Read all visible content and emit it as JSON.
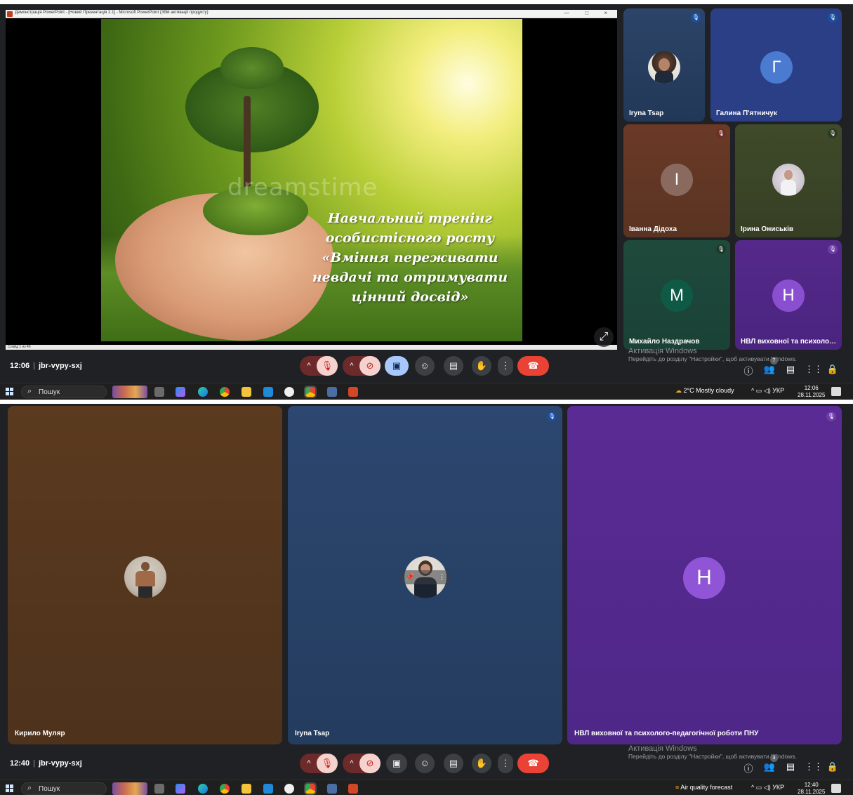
{
  "shot1": {
    "presentation": {
      "window_title": "Демонстрація PowerPoint - [Новий Презентація 2.1] - Microsoft PowerPoint (Збій активації продукту)",
      "window_controls": "— □ ×",
      "slide_lines": [
        "Навчальний тренінг",
        "особистісного росту",
        "«Вміння переживати",
        "невдачі та отримувати",
        "цінний досвід»"
      ],
      "watermark": "dreamstime",
      "status_left": "Слайд 1 из 46"
    },
    "participants": [
      {
        "name": "Iryna Tsap",
        "type": "photo"
      },
      {
        "name": "Галина П'ятничук",
        "type": "letter",
        "letter": "Г"
      },
      {
        "name": "Іванна Дідоха",
        "type": "letter",
        "letter": "І"
      },
      {
        "name": "Ірина Ониськів",
        "type": "photo"
      },
      {
        "name": "Михайло Наздрачов",
        "type": "letter",
        "letter": "М"
      },
      {
        "name": "НВЛ виховної та психоло…",
        "type": "letter",
        "letter": "Н"
      }
    ],
    "meeting": {
      "time": "12:06",
      "code": "jbr-vypy-sxj"
    },
    "participants_badge": "7",
    "taskbar": {
      "weather": "2°C Mostly cloudy",
      "lang": "УКР",
      "time": "12:06",
      "date": "28.11.2025"
    }
  },
  "shot2": {
    "participants": [
      {
        "name": "Кирило Муляр",
        "type": "photo"
      },
      {
        "name": "Iryna Tsap",
        "type": "photo"
      },
      {
        "name": "НВЛ виховної та психолого-педагогічної роботи ПНУ",
        "type": "letter",
        "letter": "Н"
      }
    ],
    "meeting": {
      "time": "12:40",
      "code": "jbr-vypy-sxj"
    },
    "participants_badge": "3",
    "taskbar": {
      "weather": "Air quality forecast",
      "lang": "УКР",
      "time": "12:40",
      "date": "28.11.2025"
    }
  },
  "activation": {
    "title": "Активація Windows",
    "subtitle": "Перейдіть до розділу \"Настройки\", щоб активувати Windows."
  },
  "taskbar_common": {
    "search_placeholder": "Пошук"
  },
  "controls": {
    "chevron": "^",
    "mic_off_icon": "mic-off-icon",
    "cam_off_icon": "camera-off-icon",
    "present_icon": "present-icon",
    "emoji_icon": "emoji-icon",
    "captions_icon": "captions-icon",
    "hand_icon": "raise-hand-icon",
    "more_icon": "more-vert-icon",
    "end_icon": "end-call-icon"
  },
  "colors": {
    "meet_bg": "#202124",
    "end_call": "#ea4335",
    "present_active": "#a8c7fa",
    "muted_button": "#f6d2cf"
  }
}
